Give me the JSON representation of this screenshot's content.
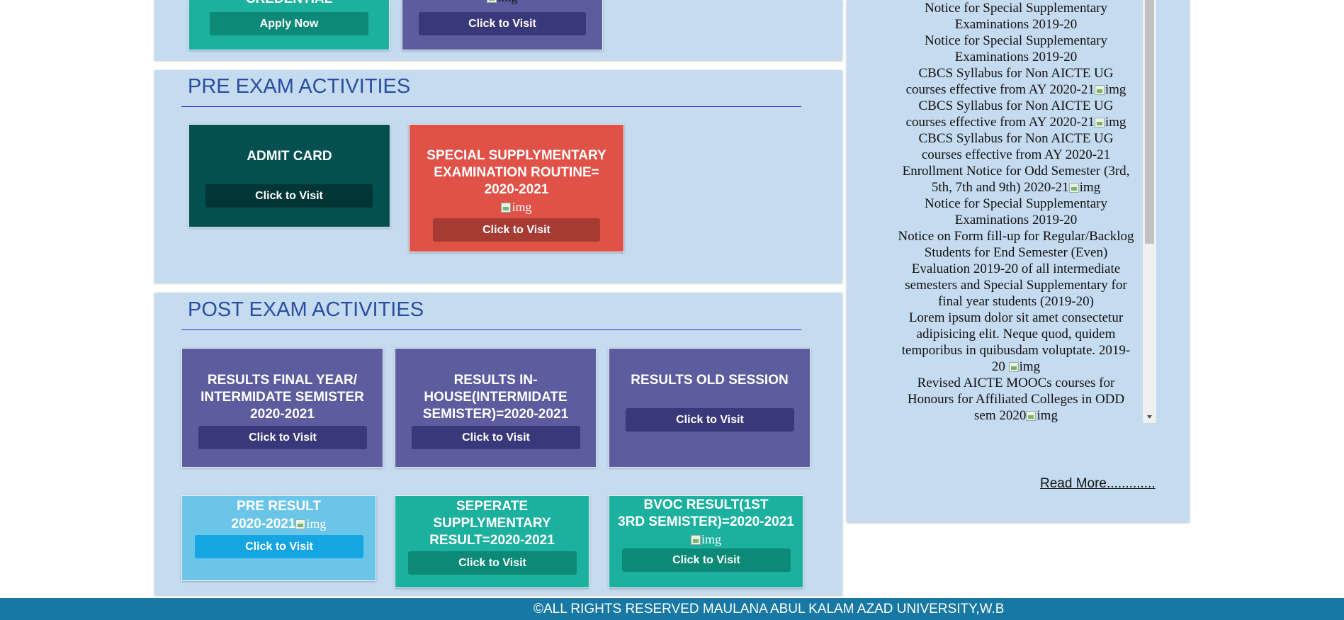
{
  "top_cards": {
    "left": {
      "title": "CREDENTIAL",
      "button": "Apply Now"
    },
    "right": {
      "img_alt": "img",
      "button": "Click to Visit"
    }
  },
  "pre_exam": {
    "heading": "PRE EXAM ACTIVITIES",
    "admit_card": {
      "title": "ADMIT CARD",
      "button": "Click to Visit"
    },
    "special_routine": {
      "title_lines": [
        "SPECIAL SUPPLYMENTARY",
        "EXAMINATION ROUTINE=",
        "2020-2021"
      ],
      "img_alt": "img",
      "button": "Click to Visit"
    }
  },
  "post_exam": {
    "heading": "POST EXAM ACTIVITIES",
    "results_final": {
      "title_lines": [
        "RESULTS FINAL YEAR/",
        "INTERMIDATE SEMISTER",
        "2020-2021"
      ],
      "button": "Click to Visit"
    },
    "results_inhouse": {
      "title_lines": [
        "RESULTS IN-",
        "HOUSE(INTERMIDATE",
        "SEMISTER)=2020-2021"
      ],
      "button": "Click to Visit"
    },
    "results_old": {
      "title": "RESULTS OLD SESSION",
      "button": "Click to Visit"
    },
    "pre_result": {
      "title_lines": [
        "PRE RESULT",
        "2020-2021"
      ],
      "img_alt": "img",
      "button": "Click to Visit"
    },
    "seperate_result": {
      "title_lines": [
        "SEPERATE",
        "SUPPLYMENTARY",
        "RESULT=2020-2021"
      ],
      "button": "Click to Visit"
    },
    "bvoc_result": {
      "title_lines": [
        "BVOC RESULT(1ST",
        "3RD SEMISTER)=2020-2021"
      ],
      "img_alt": "img",
      "button": "Click to Visit"
    }
  },
  "notices": {
    "img_alt": "img",
    "lines": [
      [
        "Notice for Special Supplementary",
        "Examinations 2019-20"
      ],
      [
        "Notice for Special Supplementary",
        "Examinations 2019-20"
      ],
      [
        "CBCS Syllabus for Non AICTE UG",
        "courses effective from AY 2020-21"
      ],
      [
        "CBCS Syllabus for Non AICTE UG",
        "courses effective from AY 2020-21"
      ],
      [
        "CBCS Syllabus for Non AICTE UG",
        "courses effective from AY 2020-21"
      ],
      [
        "Enrollment Notice for Odd Semester (3rd,",
        "5th, 7th and 9th) 2020-21"
      ],
      [
        "Notice for Special Supplementary",
        "Examinations 2019-20"
      ],
      [
        "Notice on Form fill-up for Regular/Backlog",
        "Students for End Semester (Even)"
      ],
      [
        "Evaluation 2019-20 of all intermediate",
        "semesters and Special Supplementary for",
        "final year students (2019-20)"
      ],
      [
        "Lorem ipsum dolor sit amet consectetur",
        "adipisicing elit. Neque quod, quidem",
        "temporibus in quibusdam voluptate. 2019-",
        "20"
      ],
      [
        "Revised AICTE MOOCs courses for",
        "Honours for Affiliated Colleges in ODD",
        "sem 2020"
      ]
    ],
    "read_more": "Read More............."
  },
  "footer": {
    "text": "©ALL RIGHTS RESERVED MAULANA ABUL KALAM AZAD UNIVERSITY,W.B"
  },
  "colors": {
    "panel": "#c5dbef",
    "teal": "#1cb09e",
    "teal_btn": "#0d8a77",
    "indigo": "#5c5c9e",
    "indigo_btn": "#38387a",
    "dark_teal": "#044f4f",
    "dark_teal_btn": "#023636",
    "red": "#e05148",
    "red_btn": "#a63b34",
    "sky": "#6ac5e9",
    "sky_btn": "#14a5e2",
    "footer": "#1778a3"
  }
}
